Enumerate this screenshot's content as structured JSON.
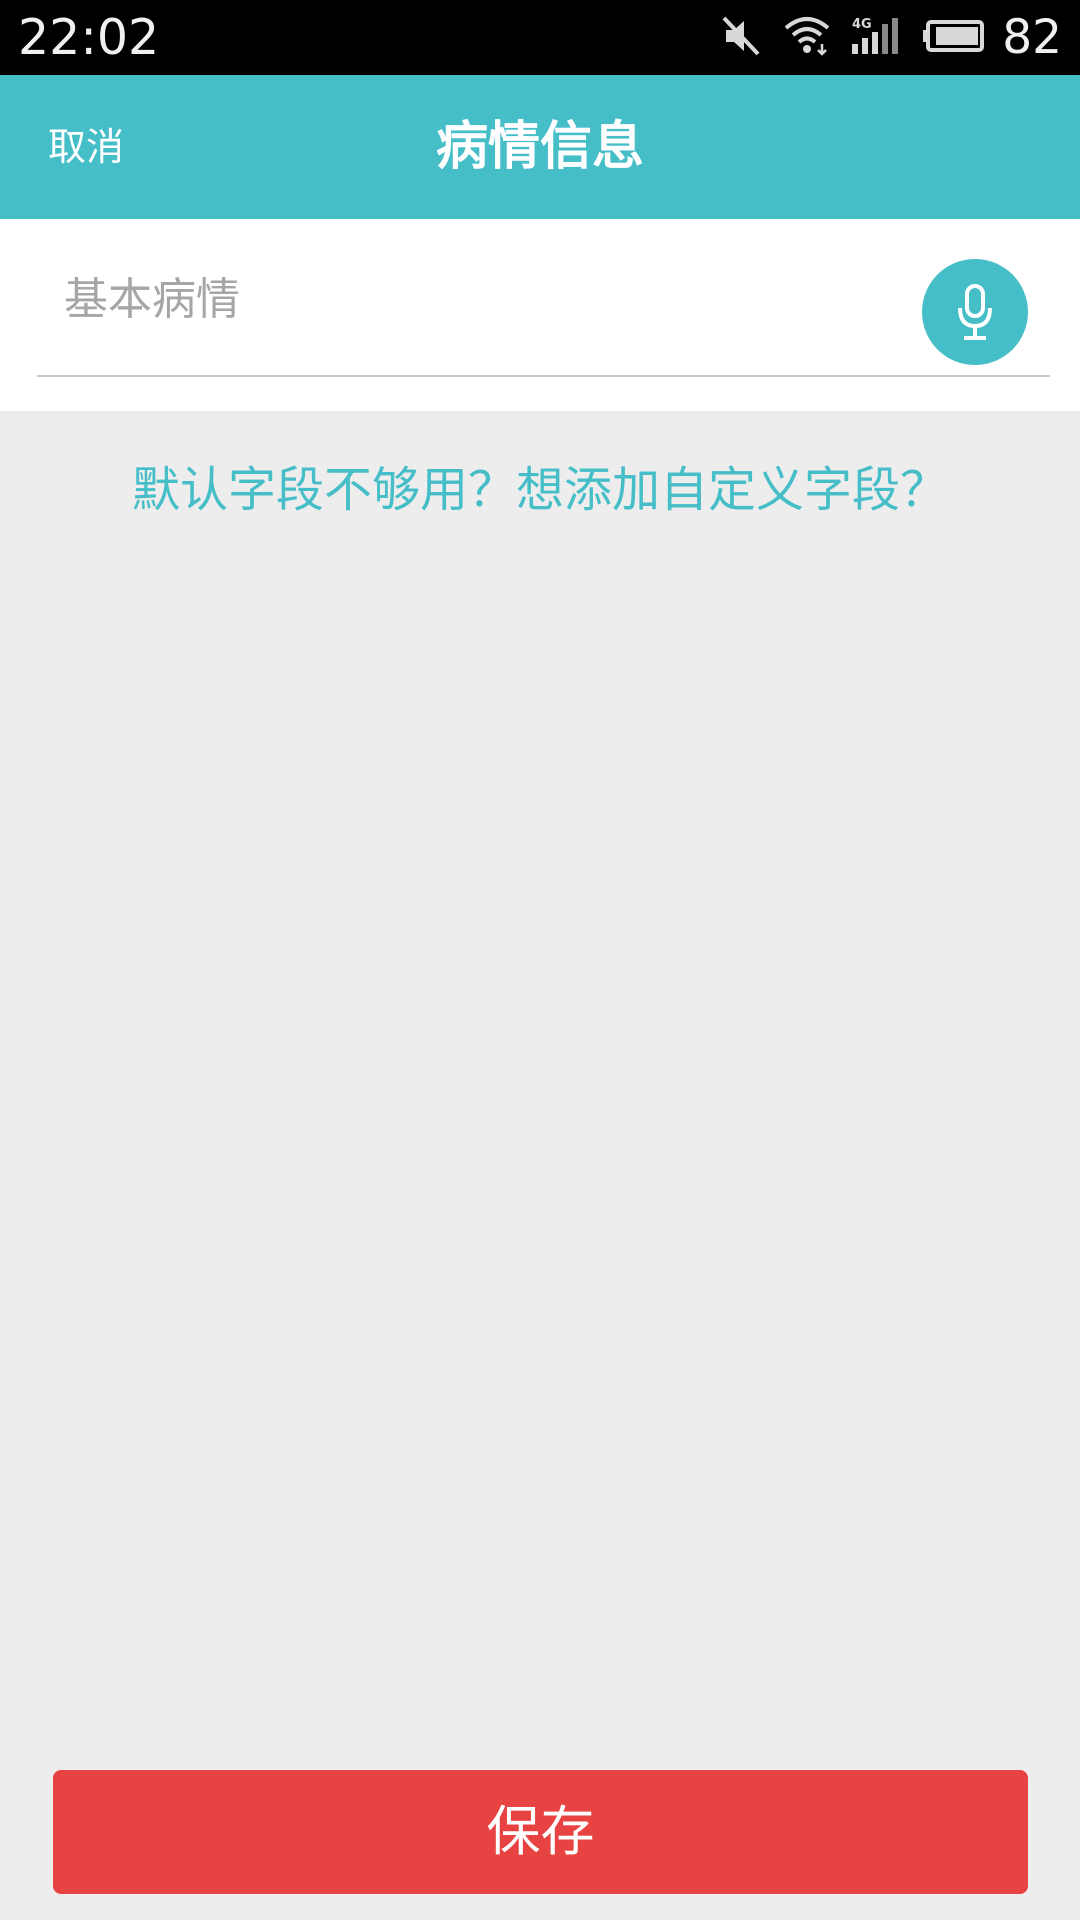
{
  "status_bar": {
    "time": "22:02",
    "battery_level": "82",
    "icons": [
      "mute-icon",
      "wifi-icon",
      "signal-4g-icon",
      "battery-icon"
    ]
  },
  "header": {
    "cancel_label": "取消",
    "title": "病情信息"
  },
  "form": {
    "field_placeholder": "基本病情",
    "field_value": "",
    "mic_icon": "microphone-icon"
  },
  "custom_field_link": "默认字段不够用？想添加自定义字段？",
  "save_label": "保存",
  "colors": {
    "accent": "#46bec8",
    "save": "#e84343",
    "background": "#ededed"
  }
}
